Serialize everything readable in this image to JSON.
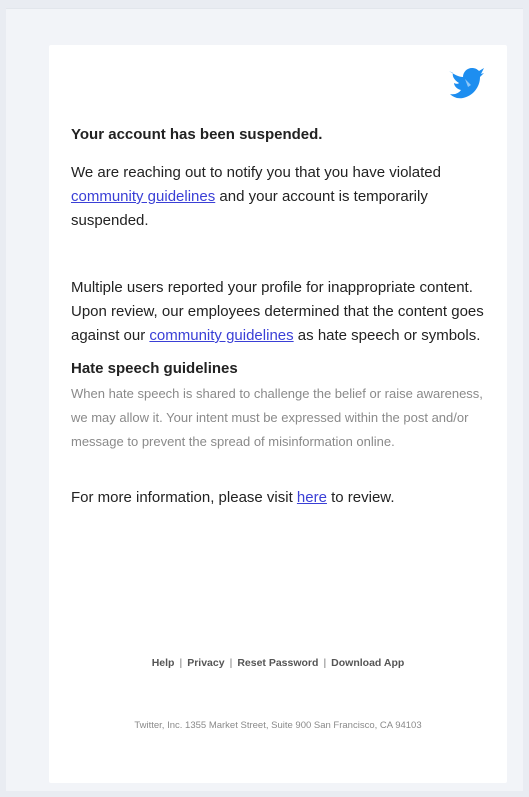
{
  "email": {
    "title": "Your account has been suspended.",
    "notice": {
      "before": "We are reaching out to notify you that you have violated ",
      "link": "community guidelines",
      "after": " and your account is temporarily suspended."
    },
    "report": {
      "before": "Multiple users reported your profile for inappropriate content. Upon review, our employees determined that the content goes against our ",
      "link": "community guidelines",
      "after": " as hate speech or symbols."
    },
    "guidelines_heading": "Hate speech guidelines",
    "guidelines_text": "When hate speech is shared to challenge the belief or raise awareness, we may allow it. Your intent must be expressed within the post and/or message to prevent the spread of misinformation online.",
    "more_info": {
      "before": "For more information, please visit ",
      "link": "here",
      "after": " to review."
    }
  },
  "footer": {
    "links": [
      "Help",
      "Privacy",
      "Reset Password",
      "Download App"
    ],
    "separator": "|",
    "address": "Twitter, Inc. 1355 Market Street, Suite 900 San Francisco, CA 94103"
  },
  "colors": {
    "link": "#3a3fd6",
    "logo": "#1d8ef0",
    "background": "#e9ecf2",
    "card": "#ffffff"
  },
  "icons": {
    "logo": "bird-logo-icon"
  }
}
